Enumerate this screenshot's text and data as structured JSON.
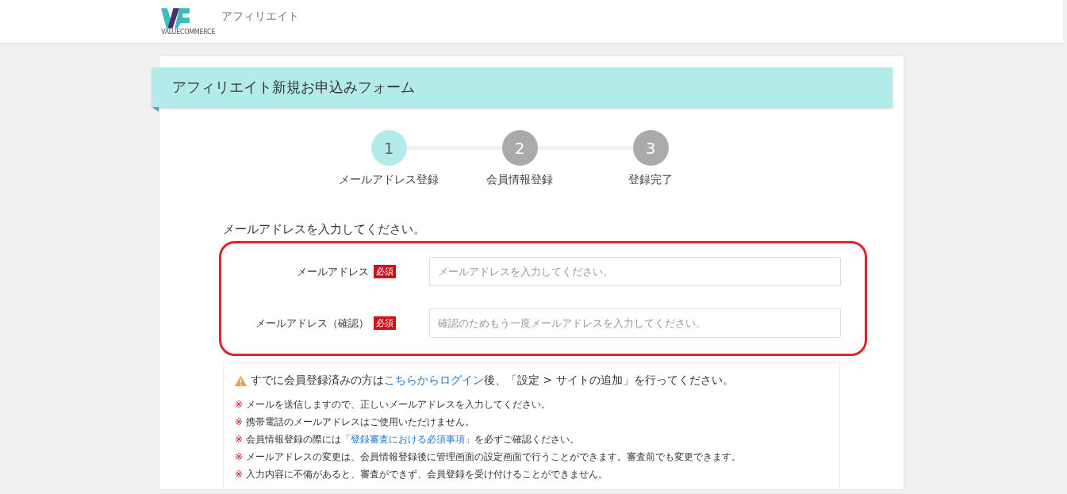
{
  "header": {
    "logo_caption": "VALUECOMMERCE",
    "site_name": "アフィリエイト"
  },
  "form_title": "アフィリエイト新規お申込みフォーム",
  "steps": [
    {
      "number": "1",
      "label": "メールアドレス登録",
      "selected": true
    },
    {
      "number": "2",
      "label": "会員情報登録",
      "selected": false
    },
    {
      "number": "3",
      "label": "登録完了",
      "selected": false
    }
  ],
  "intro": "メールアドレスを入力してください。",
  "fields": [
    {
      "label": "メールアドレス",
      "required_badge": "必須",
      "placeholder": "メールアドレスを入力してください。"
    },
    {
      "label": "メールアドレス（確認）",
      "required_badge": "必須",
      "placeholder": "確認のためもう一度メールアドレスを入力してください。"
    }
  ],
  "notice": {
    "warning": {
      "before": "すでに会員登録済みの方は",
      "link": "こちらからログイン",
      "after": "後、「設定 > サイトの追加」を行ってください。"
    },
    "notes": [
      {
        "mark": "※",
        "before": "メールを送信しますので、正しいメールアドレスを入力してください。"
      },
      {
        "mark": "※",
        "before": "携帯電話のメールアドレスはご使用いただけません。"
      },
      {
        "mark": "※",
        "before": "会員情報登録の際には",
        "link": "「登録審査における必須事項」",
        "after": "を必ずご確認ください。"
      },
      {
        "mark": "※",
        "before": "メールアドレスの変更は、会員情報登録後に管理画面の設定画面で行うことができます。審査前でも変更できます。"
      },
      {
        "mark": "※",
        "before": "入力内容に不備があると、審査ができず、会員登録を受け付けることができません。"
      }
    ]
  }
}
